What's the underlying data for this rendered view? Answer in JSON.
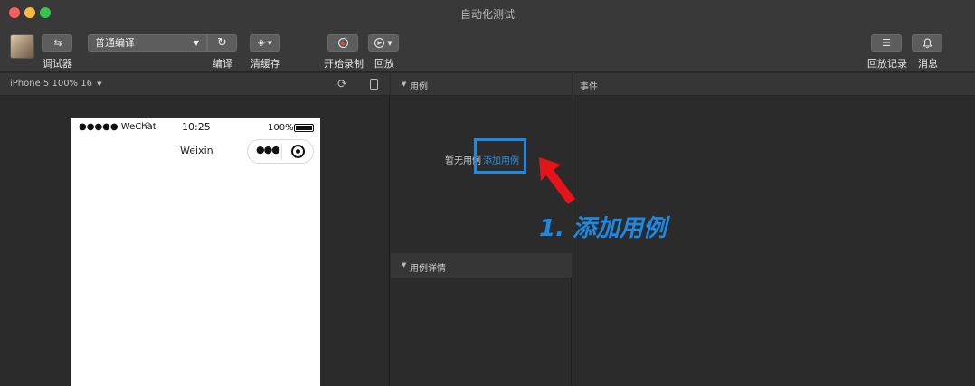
{
  "window": {
    "title": "自动化测试"
  },
  "toolbar": {
    "debugger_label": "调试器",
    "compile_mode": "普通编译",
    "compile_label": "编译",
    "clear_cache_label": "清缓存",
    "start_record_label": "开始录制",
    "replay_label": "回放",
    "replay_records_label": "回放记录",
    "messages_label": "消息"
  },
  "simulator": {
    "device": "iPhone 5 100% 16",
    "status": {
      "carrier": "●●●●● WeChat",
      "time": "10:25",
      "battery": "100%"
    },
    "nav_title": "Weixin"
  },
  "cases": {
    "title": "用例",
    "empty_text": "暂无用例",
    "add_link": "添加用例",
    "detail_title": "用例详情"
  },
  "events": {
    "title": "事件"
  },
  "annotation": {
    "text": "1. 添加用例",
    "color": "#1e88e5"
  },
  "colors": {
    "accent": "#1e88e5",
    "arrow": "#e5141b",
    "record_dot": "#e8473f"
  }
}
